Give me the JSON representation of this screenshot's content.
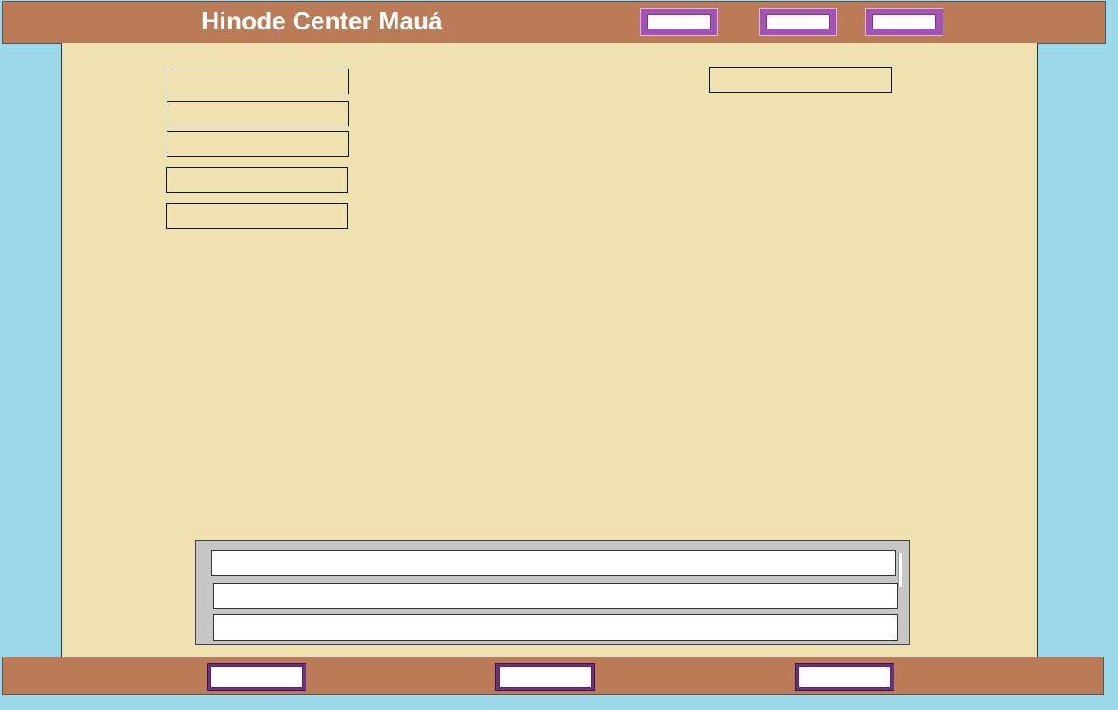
{
  "header": {
    "title": "Hinode Center Mauá",
    "nav_buttons": [
      {
        "label": ""
      },
      {
        "label": ""
      },
      {
        "label": ""
      }
    ]
  },
  "form": {
    "left_fields": [
      {
        "value": ""
      },
      {
        "value": ""
      },
      {
        "value": ""
      },
      {
        "value": ""
      },
      {
        "value": ""
      }
    ],
    "right_field": {
      "value": ""
    }
  },
  "list": {
    "rows": [
      {
        "text": ""
      },
      {
        "text": ""
      },
      {
        "text": ""
      }
    ]
  },
  "footer": {
    "buttons": [
      {
        "label": ""
      },
      {
        "label": ""
      },
      {
        "label": ""
      }
    ]
  },
  "colors": {
    "background": "#9bd9ea",
    "header_bar": "#bb7b56",
    "panel": "#efe2b0",
    "top_button": "#a552b8",
    "bottom_button": "#722f82",
    "list_panel": "#c6c6c6"
  }
}
